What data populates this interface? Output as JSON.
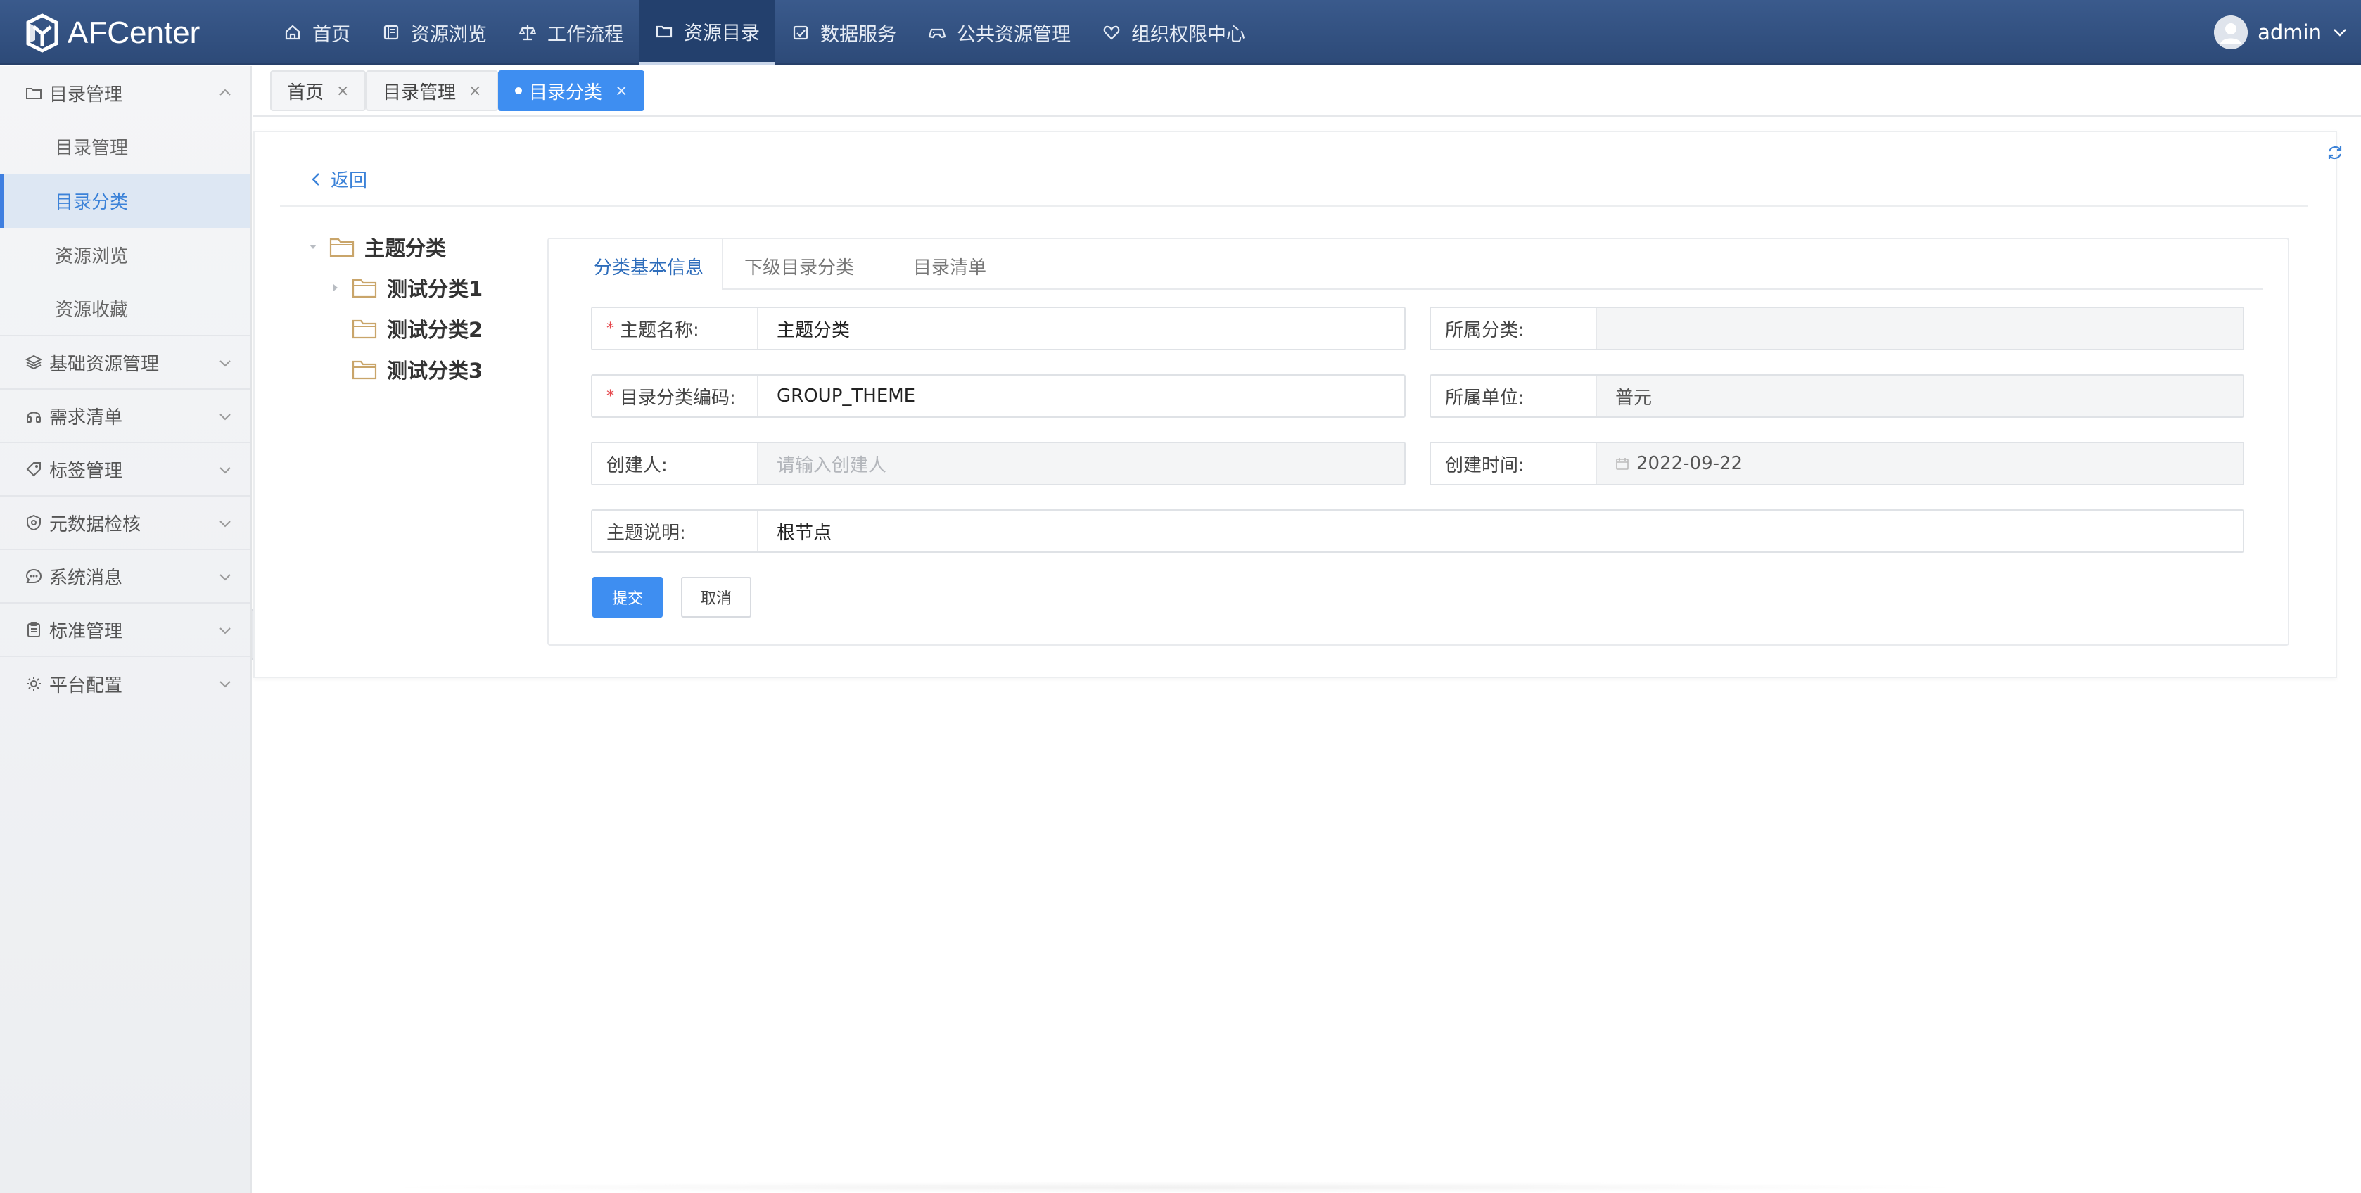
{
  "app": {
    "name": "AFCenter"
  },
  "nav": {
    "items": [
      {
        "label": "首页",
        "icon": "home-icon"
      },
      {
        "label": "资源浏览",
        "icon": "book-icon"
      },
      {
        "label": "工作流程",
        "icon": "scale-icon"
      },
      {
        "label": "资源目录",
        "icon": "folder-icon",
        "active": true
      },
      {
        "label": "数据服务",
        "icon": "calendar-check-icon"
      },
      {
        "label": "公共资源管理",
        "icon": "gamepad-icon"
      },
      {
        "label": "组织权限中心",
        "icon": "heart-icon"
      }
    ]
  },
  "user": {
    "name": "admin"
  },
  "sidebar": {
    "open_group": {
      "label": "目录管理",
      "icon": "folder-icon"
    },
    "sub_items": [
      {
        "label": "目录管理"
      },
      {
        "label": "目录分类",
        "active": true
      },
      {
        "label": "资源浏览"
      },
      {
        "label": "资源收藏"
      }
    ],
    "groups": [
      {
        "label": "基础资源管理",
        "icon": "layers-icon"
      },
      {
        "label": "需求清单",
        "icon": "headset-icon"
      },
      {
        "label": "标签管理",
        "icon": "tag-icon"
      },
      {
        "label": "元数据检核",
        "icon": "shield-icon"
      },
      {
        "label": "系统消息",
        "icon": "chat-icon"
      },
      {
        "label": "标准管理",
        "icon": "clipboard-icon"
      },
      {
        "label": "平台配置",
        "icon": "gear-icon"
      }
    ]
  },
  "page_tabs": [
    {
      "label": "首页",
      "close": "×"
    },
    {
      "label": "目录管理",
      "close": "×"
    },
    {
      "label": "目录分类",
      "close": "×",
      "active": true
    }
  ],
  "back": {
    "label": "返回"
  },
  "tree": {
    "root": "主题分类",
    "children": [
      "测试分类1",
      "测试分类2",
      "测试分类3"
    ]
  },
  "content_tabs": [
    {
      "label": "分类基本信息",
      "active": true
    },
    {
      "label": "下级目录分类"
    },
    {
      "label": "目录清单"
    }
  ],
  "form": {
    "theme_name": {
      "label": "主题名称:",
      "value": "主题分类",
      "required": "*"
    },
    "parent_category": {
      "label": "所属分类:",
      "value": ""
    },
    "category_code": {
      "label": "目录分类编码:",
      "value": "GROUP_THEME",
      "required": "*"
    },
    "unit": {
      "label": "所属单位:",
      "value": "普元"
    },
    "creator": {
      "label": "创建人:",
      "placeholder": "请输入创建人"
    },
    "created_time": {
      "label": "创建时间:",
      "value": "2022-09-22"
    },
    "description": {
      "label": "主题说明:",
      "value": "根节点"
    }
  },
  "buttons": {
    "submit": "提交",
    "cancel": "取消"
  },
  "colors": {
    "topbar": "#2d4a78",
    "primary": "#3e8ef1",
    "link": "#3b82d8",
    "required": "#e5484d"
  }
}
